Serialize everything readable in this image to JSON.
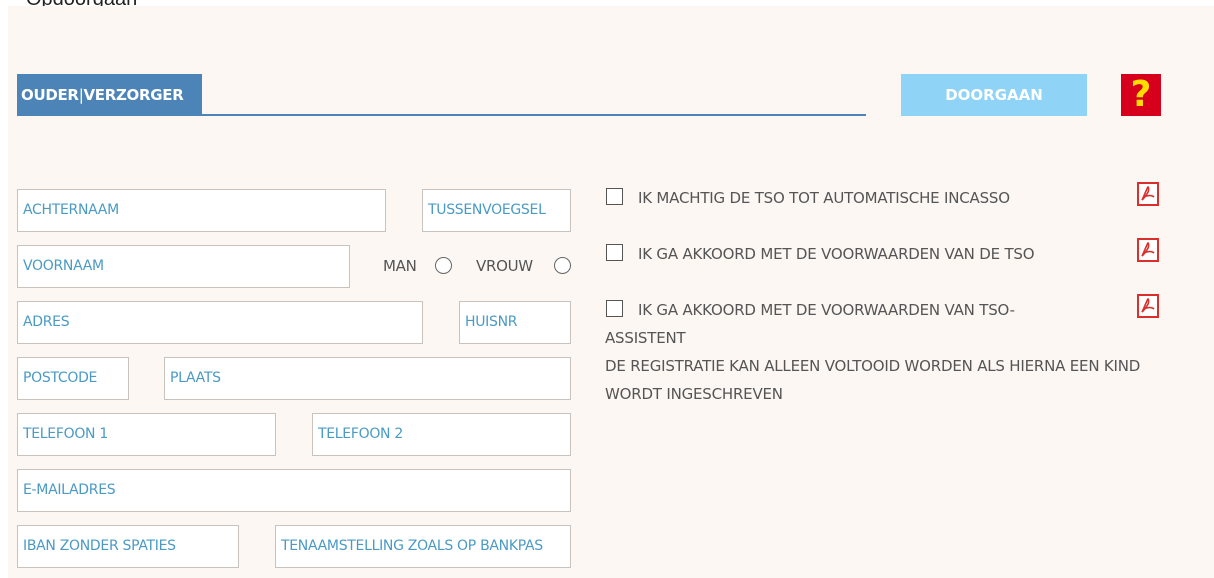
{
  "caption": "Opdoorgaan",
  "header": {
    "tab_left": "OUDER",
    "tab_separator": "|",
    "tab_right": "VERZORGER",
    "continue_label": "DOORGAAN",
    "help_symbol": "?"
  },
  "form": {
    "achternaam": "ACHTERNAAM",
    "tussenvoegsel": "TUSSENVOEGSEL",
    "voornaam": "VOORNAAM",
    "gender_male": "MAN",
    "gender_female": "VROUW",
    "adres": "ADRES",
    "huisnr": "HUISNR",
    "postcode": "POSTCODE",
    "plaats": "PLAATS",
    "telefoon1": "TELEFOON 1",
    "telefoon2": "TELEFOON 2",
    "email": "E-MAILADRES",
    "iban": "IBAN ZONDER SPATIES",
    "tenaamstelling": "TENAAMSTELLING ZOALS OP BANKPAS"
  },
  "agreements": [
    {
      "label": "IK MACHTIG DE TSO TOT AUTOMATISCHE INCASSO",
      "checked": false
    },
    {
      "label": "IK GA AKKOORD MET DE VOORWAARDEN VAN DE TSO",
      "checked": false
    },
    {
      "label": "IK GA AKKOORD MET DE VOORWAARDEN VAN TSO-ASSISTENT",
      "checked": false
    }
  ],
  "note": "DE REGISTRATIE KAN ALLEEN VOLTOOID WORDEN ALS HIERNA EEN KIND WORDT INGESCHREVEN",
  "colors": {
    "header_blue": "#4d84b8",
    "button_light_blue": "#8fd3f7",
    "help_red": "#d6001c",
    "help_yellow": "#ffdd00",
    "field_text": "#4a9ac4",
    "pdf_red": "#d9302c",
    "panel_bg": "#fdf7f3"
  },
  "icons": {
    "help": "question-mark-icon",
    "pdf": "pdf-icon"
  }
}
